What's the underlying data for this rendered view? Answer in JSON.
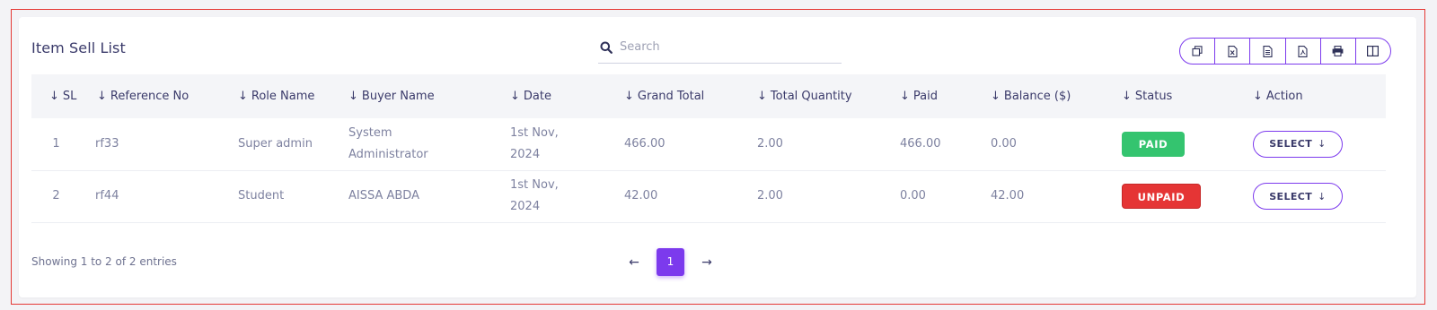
{
  "header": {
    "title": "Item Sell List"
  },
  "search": {
    "placeholder": "Search"
  },
  "exports": [
    "copy-icon",
    "excel-icon",
    "csv-icon",
    "pdf-icon",
    "print-icon",
    "columns-icon"
  ],
  "table": {
    "columns": [
      "SL",
      "Reference No",
      "Role Name",
      "Buyer Name",
      "Date",
      "Grand Total",
      "Total Quantity",
      "Paid",
      "Balance ($)",
      "Status",
      "Action"
    ],
    "rows": [
      {
        "sl": "1",
        "reference": "rf33",
        "role": "Super admin",
        "buyer": "System Administrator",
        "date": "1st Nov, 2024",
        "grand_total": "466.00",
        "quantity": "2.00",
        "paid": "466.00",
        "balance": "0.00",
        "status": "PAID",
        "action": "SELECT"
      },
      {
        "sl": "2",
        "reference": "rf44",
        "role": "Student",
        "buyer": "AISSA ABDA",
        "date": "1st Nov, 2024",
        "grand_total": "42.00",
        "quantity": "2.00",
        "paid": "0.00",
        "balance": "42.00",
        "status": "UNPAID",
        "action": "SELECT"
      }
    ]
  },
  "footer": {
    "entries": "Showing 1 to 2 of 2 entries",
    "current_page": "1",
    "prev": "←",
    "next": "→"
  },
  "colors": {
    "accent": "#7c3aed",
    "paid": "#34c46f",
    "unpaid": "#e53535",
    "text": "#3a3a6a",
    "muted": "#7e82a0"
  }
}
